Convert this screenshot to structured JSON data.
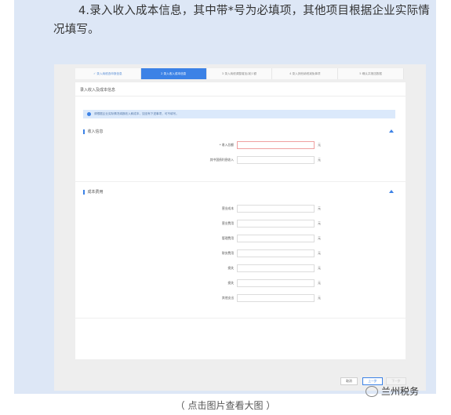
{
  "intro_text": "4.录入收入成本信息，其中带*号为必填项，其他项目根据企业实际情况填写。",
  "steps": [
    "✓ 录入纳税选申报信息",
    "2 录入收入成本信息",
    "3 录入纳税调整增加/减少额",
    "4 录入其他纳税减免事项",
    "5 确认并报送数据"
  ],
  "card_title": "录入收入及成本信息",
  "notice": "请根据企业实际情况填报收入和成本，如没有下述事项，可不填写。",
  "income_section": {
    "title": "收入信息",
    "rows": [
      {
        "label": "* 收入总额",
        "unit": "元"
      },
      {
        "label": "其中国债利息收入",
        "unit": "元"
      }
    ]
  },
  "cost_section": {
    "title": "成本费用",
    "rows": [
      {
        "label": "营业成本",
        "unit": "元"
      },
      {
        "label": "营业费用",
        "unit": "元"
      },
      {
        "label": "管理费用",
        "unit": "元"
      },
      {
        "label": "财务费用",
        "unit": "元"
      },
      {
        "label": "损失",
        "unit": "元"
      },
      {
        "label": "损失",
        "unit": "元"
      },
      {
        "label": "其他支出",
        "unit": "元"
      }
    ]
  },
  "buttons": {
    "cancel": "取消",
    "prev": "上一步",
    "next": "下一步"
  },
  "caption": "（ 点击图片查看大图 ）",
  "brand": "兰州税务",
  "colors": {
    "accent": "#3c82e6",
    "panel_bg": "#dde7f6"
  }
}
